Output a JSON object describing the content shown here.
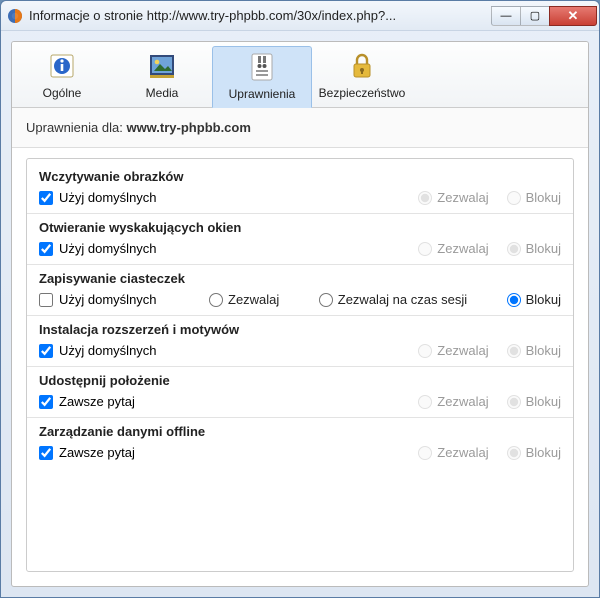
{
  "window": {
    "title": "Informacje o stronie http://www.try-phpbb.com/30x/index.php?...",
    "buttons": {
      "min": "—",
      "max": "▢",
      "close": "✕"
    }
  },
  "tabs": {
    "general": "Ogólne",
    "media": "Media",
    "permissions": "Uprawnienia",
    "security": "Bezpieczeństwo"
  },
  "subheader": {
    "prefix": "Uprawnienia dla: ",
    "host": "www.try-phpbb.com"
  },
  "labels": {
    "use_default": "Użyj domyślnych",
    "always_ask": "Zawsze pytaj",
    "allow": "Zezwalaj",
    "allow_session": "Zezwalaj na czas sesji",
    "block": "Blokuj"
  },
  "sections": {
    "load_images": "Wczytywanie obrazków",
    "popups": "Otwieranie wyskakujących okien",
    "cookies": "Zapisywanie ciasteczek",
    "extensions": "Instalacja rozszerzeń i motywów",
    "location": "Udostępnij położenie",
    "offline": "Zarządzanie danymi offline"
  }
}
